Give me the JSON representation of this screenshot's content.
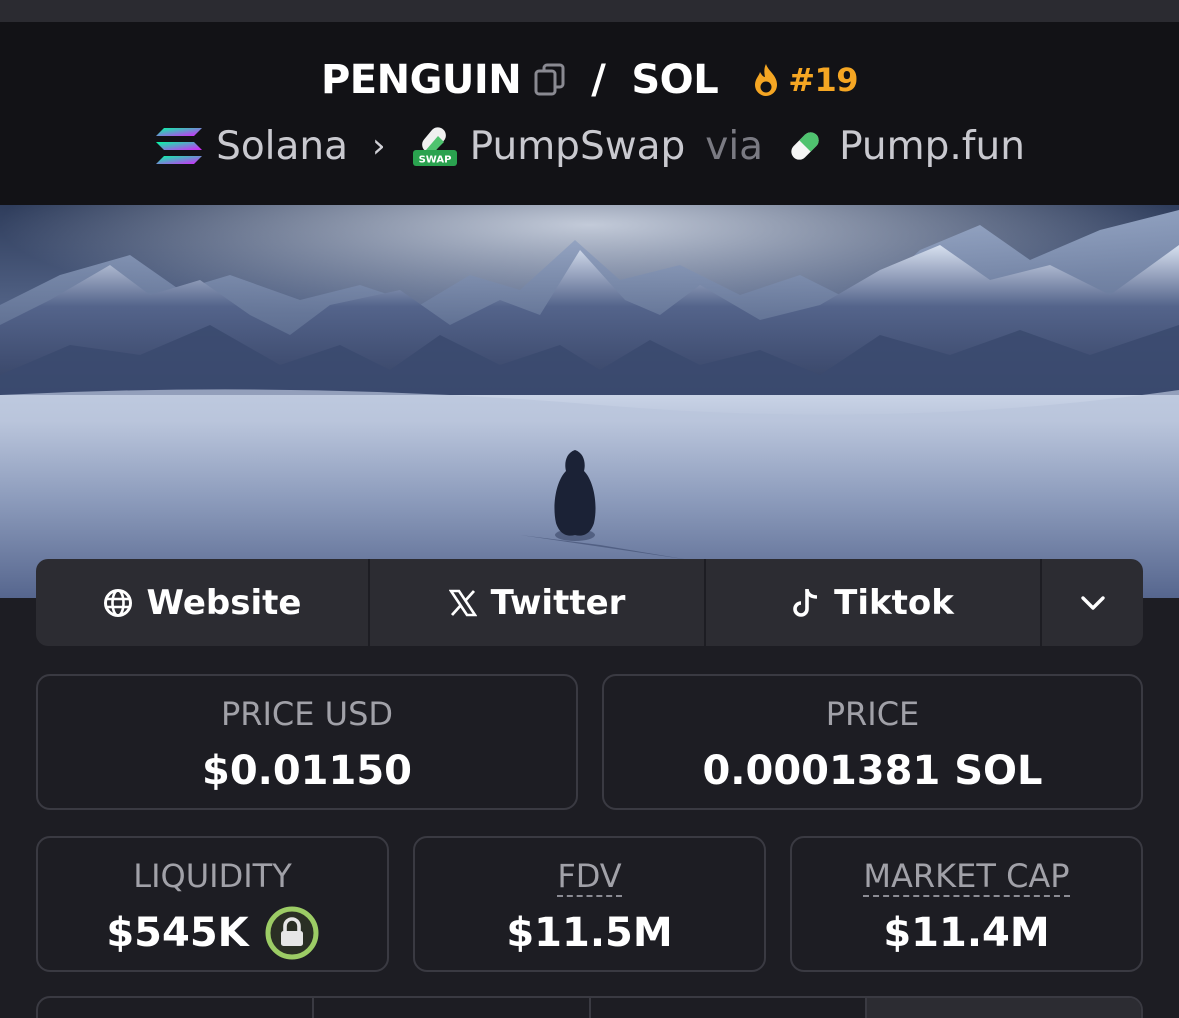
{
  "header": {
    "base_token": "PENGUIN",
    "separator": "/",
    "quote_token": "SOL",
    "rank": "#19",
    "chain": "Solana",
    "dex": "PumpSwap",
    "via": "via",
    "launchpad": "Pump.fun",
    "icons": [
      "copy-icon",
      "flame-icon",
      "solana-logo-icon",
      "chevron-right-icon",
      "pumpswap-logo-icon",
      "pill-icon"
    ]
  },
  "links": {
    "website": "Website",
    "twitter": "Twitter",
    "tiktok": "Tiktok"
  },
  "stats": {
    "price_usd": {
      "label": "PRICE USD",
      "value": "$0.01150"
    },
    "price": {
      "label": "PRICE",
      "value": "0.0001381 SOL"
    },
    "liquidity": {
      "label": "LIQUIDITY",
      "value": "$545K"
    },
    "fdv": {
      "label": "FDV",
      "value": "$11.5M"
    },
    "market_cap": {
      "label": "MARKET CAP",
      "value": "$11.4M"
    }
  },
  "colors": {
    "accent_rank": "#f5a623",
    "lock_ring": "#9ccc65",
    "background": "#1d1d23",
    "header_bg": "#121216"
  }
}
